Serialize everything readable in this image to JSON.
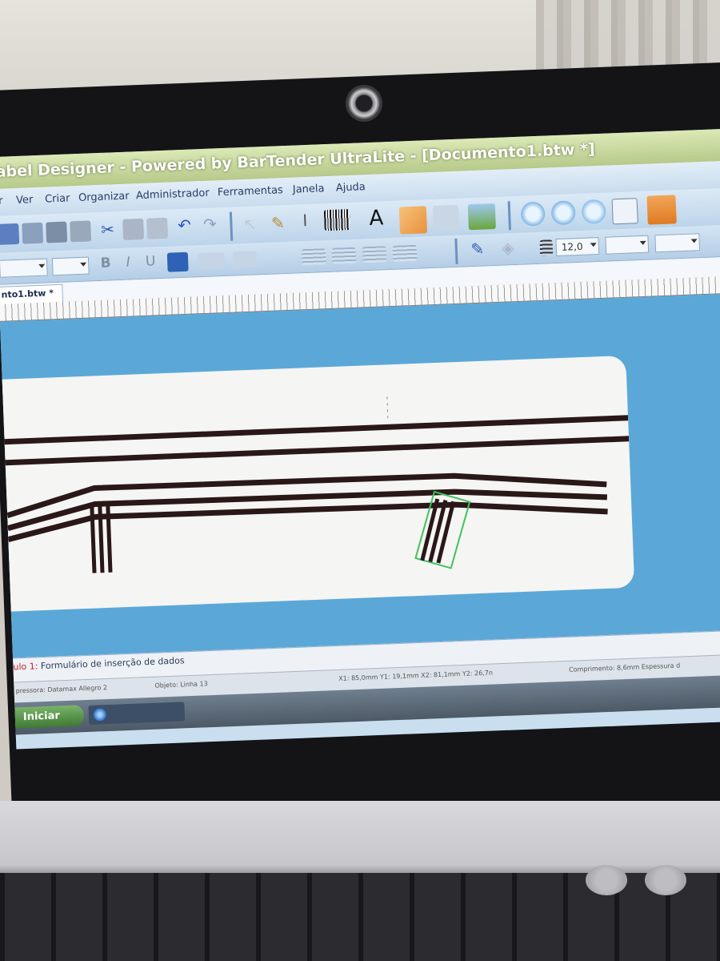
{
  "window": {
    "title": "abel Designer - Powered by BarTender UltraLite - [Documento1.btw *]"
  },
  "menu": {
    "items": [
      "r",
      "Ver",
      "Criar",
      "Organizar",
      "Administrador",
      "Ferramentas",
      "Janela",
      "Ajuda"
    ]
  },
  "toolbar": {
    "line_width_value": "12,0"
  },
  "document_tab": {
    "label": "nto1.btw *"
  },
  "form_tab": {
    "number_label": "ulo 1:",
    "text": "Formulário de inserção de dados"
  },
  "statusbar": {
    "left_text": "pressora: Datamax Allegro 2",
    "object_text": "Objeto: Linha 13",
    "coords_text": "X1: 85,0mm  Y1: 19,1mm  X2: 81,1mm  Y2: 26,7n",
    "length_text": "Comprimento: 8,6mm  Espessura d"
  },
  "taskbar": {
    "start_label": "Iniciar"
  },
  "colors": {
    "canvas_blue": "#5ba8d8",
    "line_color": "#2a1818",
    "selection_green": "#3ec35a"
  },
  "icons": [
    "new-icon",
    "open-icon",
    "save-icon",
    "print-icon",
    "cut-icon",
    "copy-icon",
    "paste-icon",
    "undo-icon",
    "redo-icon",
    "pointer-icon",
    "brush-icon",
    "text-cursor-icon",
    "barcode-icon",
    "text-icon",
    "line-icon",
    "shape-icon",
    "picture-icon",
    "zoom-in-icon",
    "zoom-out-icon",
    "zoom-window-icon",
    "fit-page-icon",
    "page-setup-icon"
  ]
}
